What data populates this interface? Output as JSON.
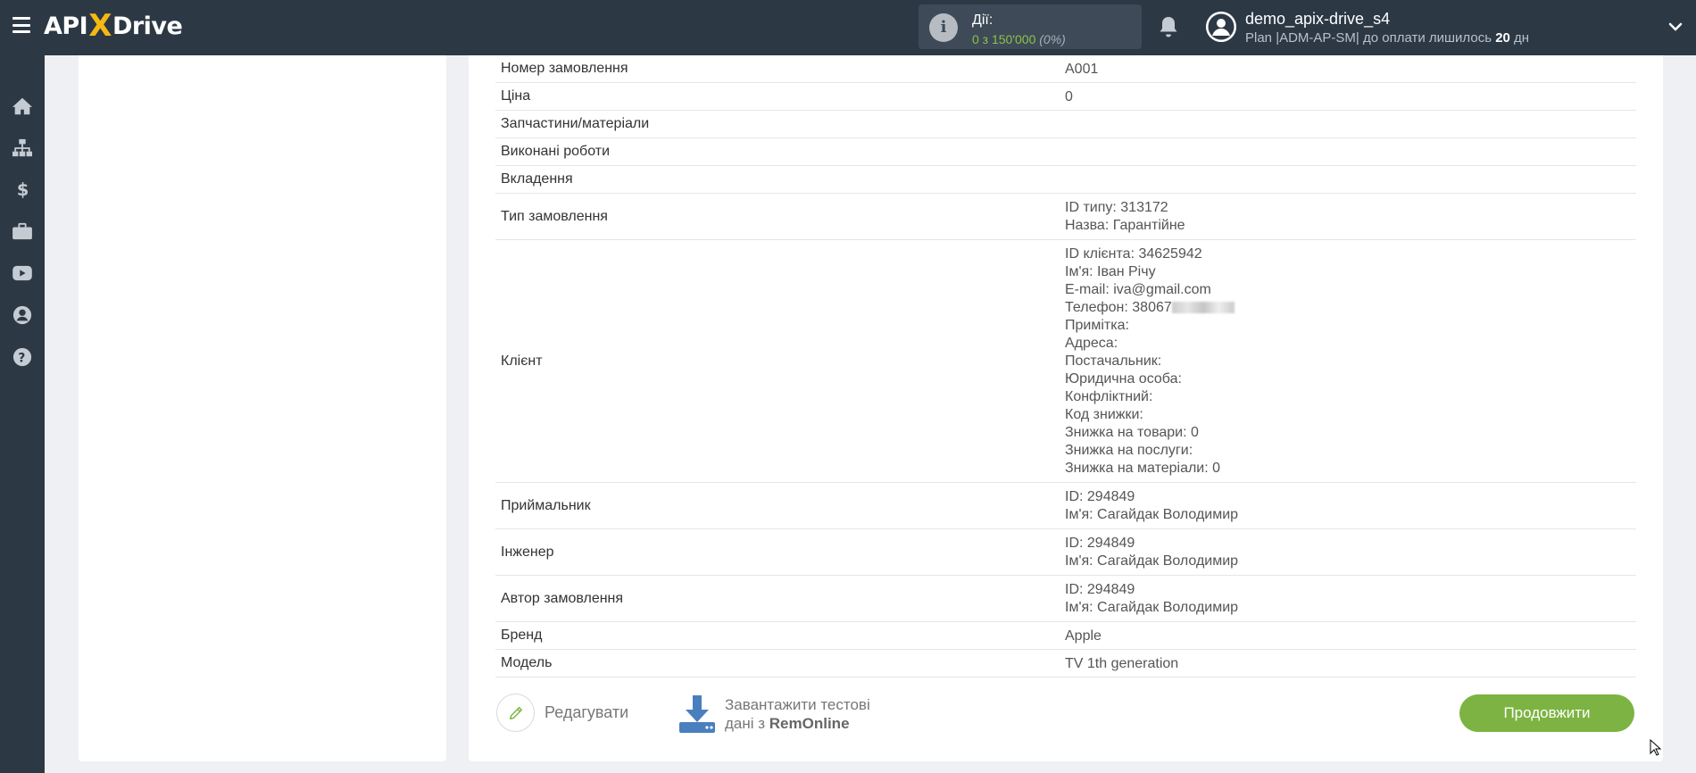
{
  "header": {
    "logo_left": "API",
    "logo_x": "X",
    "logo_right": "Drive",
    "actions_label": "Дії:",
    "actions_value": "0 з 150'000",
    "actions_percent": "(0%)",
    "user_name": "demo_apix-drive_s4",
    "plan_text": "Plan |ADM-AP-SM| до оплати лишилось",
    "plan_days": "20",
    "plan_days_unit": "дн"
  },
  "sidebar": {
    "items": [
      "home-icon",
      "sitemap-icon",
      "dollar-icon",
      "briefcase-icon",
      "youtube-icon",
      "user-icon",
      "help-icon"
    ]
  },
  "rows": [
    {
      "label": "Номер замовлення",
      "lines": [
        "A001"
      ]
    },
    {
      "label": "Ціна",
      "lines": [
        "0"
      ]
    },
    {
      "label": "Запчастини/матеріали",
      "lines": []
    },
    {
      "label": "Виконані роботи",
      "lines": []
    },
    {
      "label": "Вкладення",
      "lines": []
    },
    {
      "label": "Тип замовлення",
      "lines": [
        "ID типу: 313172",
        "Назва: Гарантійне"
      ]
    },
    {
      "label": "Клієнт",
      "lines": [
        "ID клієнта: 34625942",
        "Ім'я: Іван Річу",
        "E-mail: iva@gmail.com",
        "Телефон: 38067",
        "Примітка:",
        "Адреса:",
        "Постачальник:",
        "Юридична особа:",
        "Конфліктний:",
        "Код знижки:",
        "Знижка на товари: 0",
        "Знижка на послуги:",
        "Знижка на матеріали: 0"
      ]
    },
    {
      "label": "Приймальник",
      "lines": [
        "ID: 294849",
        "Ім'я: Сагайдак Володимир"
      ]
    },
    {
      "label": "Інженер",
      "lines": [
        "ID: 294849",
        "Ім'я: Сагайдак Володимир"
      ]
    },
    {
      "label": "Автор замовлення",
      "lines": [
        "ID: 294849",
        "Ім'я: Сагайдак Володимир"
      ]
    },
    {
      "label": "Бренд",
      "lines": [
        "Apple"
      ]
    },
    {
      "label": "Модель",
      "lines": [
        "TV 1th generation"
      ]
    }
  ],
  "actions": {
    "edit_label": "Редагувати",
    "load_line1": "Завантажити тестові",
    "load_line2_prefix": "дані з ",
    "load_line2_brand": "RemOnline",
    "continue_label": "Продовжити"
  },
  "colors": {
    "topbar": "#2d3845",
    "accent_green": "#7cb342",
    "logo_x": "#f5b914"
  }
}
